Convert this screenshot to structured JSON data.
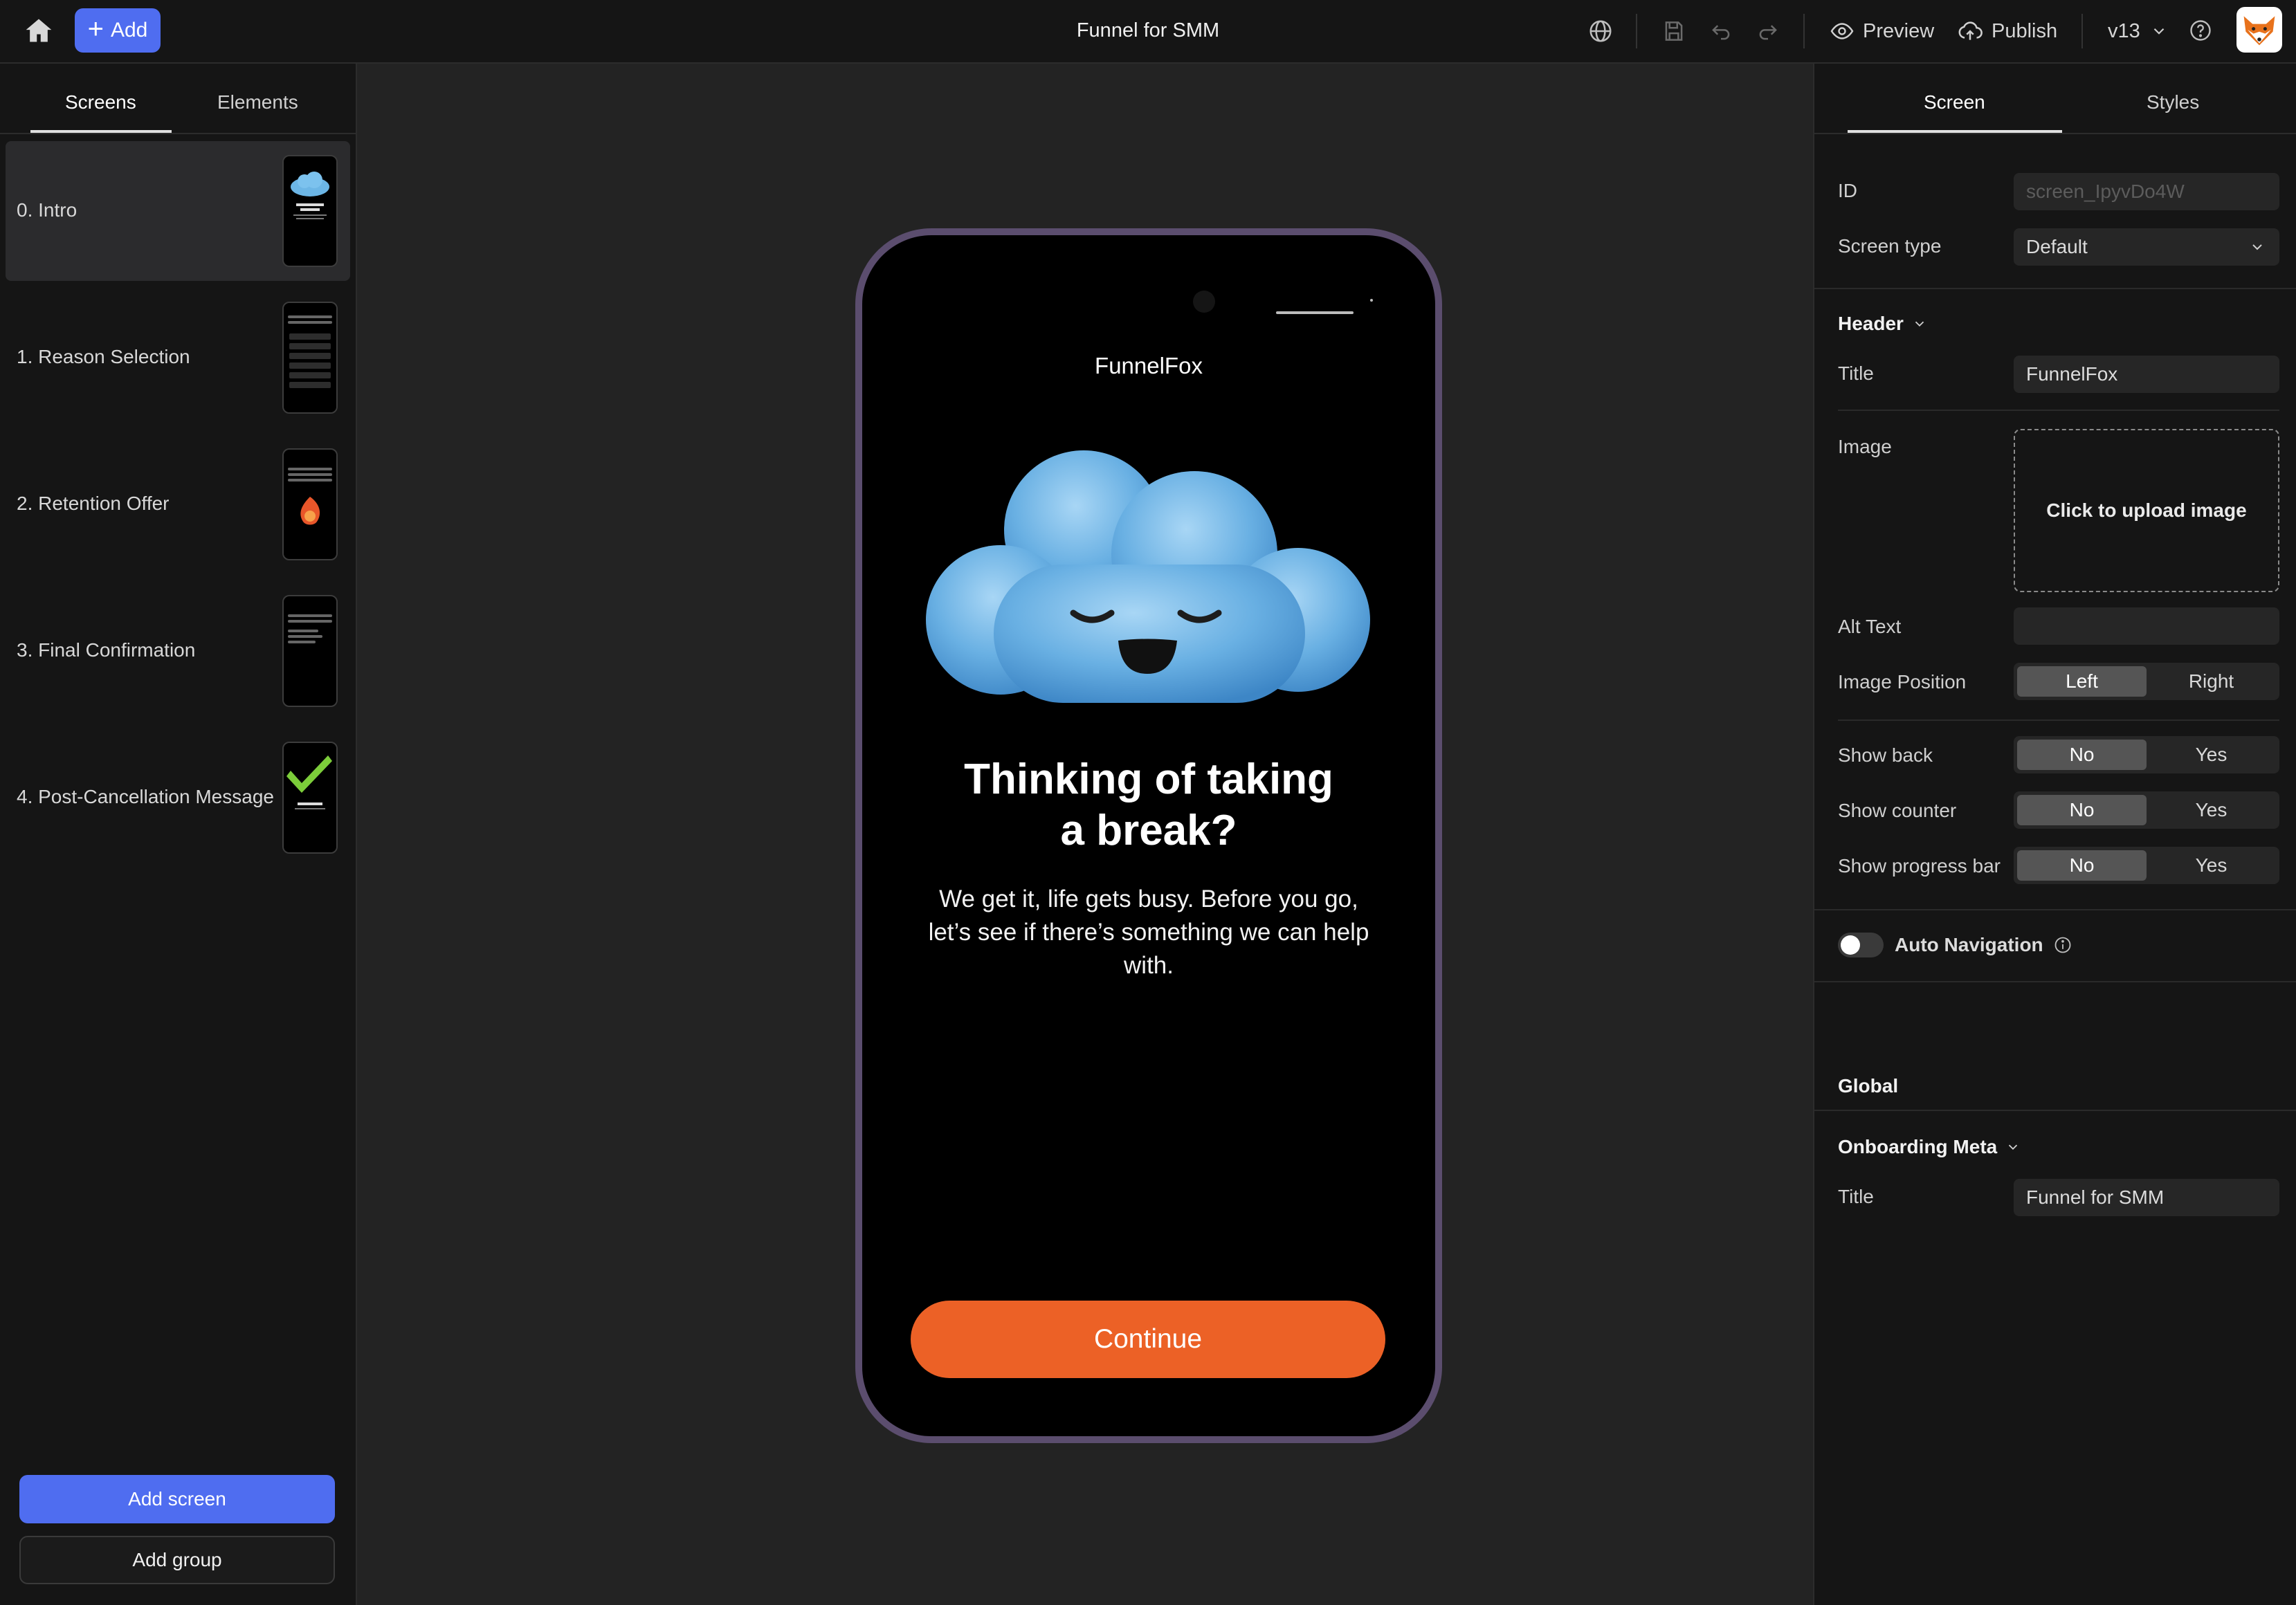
{
  "topbar": {
    "add_label": "Add",
    "title": "Funnel for SMM",
    "preview_label": "Preview",
    "publish_label": "Publish",
    "version": "v13"
  },
  "left": {
    "tabs": [
      {
        "label": "Screens",
        "active": true
      },
      {
        "label": "Elements",
        "active": false
      }
    ],
    "screens": [
      {
        "label": "0.  Intro",
        "active": true
      },
      {
        "label": "1.  Reason Selection",
        "active": false
      },
      {
        "label": "2.  Retention Offer",
        "active": false
      },
      {
        "label": "3.  Final Confirmation",
        "active": false
      },
      {
        "label": "4.  Post-Cancellation Message",
        "active": false
      }
    ],
    "add_screen_label": "Add screen",
    "add_group_label": "Add group"
  },
  "phone": {
    "header_title": "FunnelFox",
    "headline_line1": "Thinking of taking",
    "headline_line2": "a break?",
    "body": "We get it, life gets busy. Before you go, let’s see if there’s something we can help with.",
    "cta_label": "Continue",
    "cta_color": "#ec6126"
  },
  "right": {
    "tabs": [
      {
        "label": "Screen",
        "active": true
      },
      {
        "label": "Styles",
        "active": false
      }
    ],
    "id_label": "ID",
    "id_value": "screen_IpyvDo4W",
    "screen_type_label": "Screen type",
    "screen_type_value": "Default",
    "header_section": "Header",
    "title_label": "Title",
    "title_value": "FunnelFox",
    "image_label": "Image",
    "upload_label": "Click to upload image",
    "alt_text_label": "Alt Text",
    "alt_text_value": "",
    "image_position_label": "Image Position",
    "image_position_options": [
      "Left",
      "Right"
    ],
    "image_position_selected": "Left",
    "show_back_label": "Show back",
    "show_counter_label": "Show counter",
    "show_progress_label": "Show progress bar",
    "no_label": "No",
    "yes_label": "Yes",
    "auto_navigation_label": "Auto Navigation",
    "auto_navigation_enabled": false,
    "global_section": "Global",
    "onboarding_meta_section": "Onboarding Meta",
    "meta_title_label": "Title",
    "meta_title_value": "Funnel for SMM"
  },
  "colors": {
    "accent": "#4f6df0",
    "cta": "#ec6126",
    "phone_frame": "#5b4d6e"
  }
}
